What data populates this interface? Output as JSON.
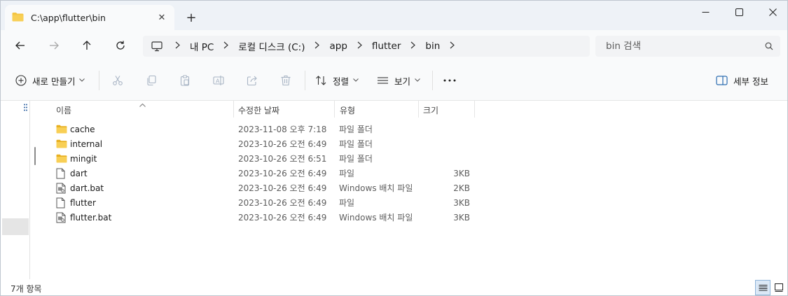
{
  "window": {
    "tab_title": "C:\\app\\flutter\\bin",
    "tab_close": "✕",
    "new_tab": "+"
  },
  "address": {
    "crumbs": [
      "내 PC",
      "로컬 디스크 (C:)",
      "app",
      "flutter",
      "bin"
    ]
  },
  "search": {
    "placeholder": "bin 검색"
  },
  "commands": {
    "new_label": "새로 만들기",
    "sort_label": "정렬",
    "view_label": "보기",
    "details_label": "세부 정보"
  },
  "columns": {
    "name": "이름",
    "modified": "수정한 날짜",
    "type": "유형",
    "size": "크기"
  },
  "files": [
    {
      "name": "cache",
      "modified": "2023-11-08 오후 7:18",
      "type": "파일 폴더",
      "size": "",
      "icon": "folder-icon"
    },
    {
      "name": "internal",
      "modified": "2023-10-26 오전 6:49",
      "type": "파일 폴더",
      "size": "",
      "icon": "folder-icon"
    },
    {
      "name": "mingit",
      "modified": "2023-10-26 오전 6:51",
      "type": "파일 폴더",
      "size": "",
      "icon": "folder-icon"
    },
    {
      "name": "dart",
      "modified": "2023-10-26 오전 6:49",
      "type": "파일",
      "size": "3KB",
      "icon": "file-icon"
    },
    {
      "name": "dart.bat",
      "modified": "2023-10-26 오전 6:49",
      "type": "Windows 배치 파일",
      "size": "2KB",
      "icon": "batch-file-icon"
    },
    {
      "name": "flutter",
      "modified": "2023-10-26 오전 6:49",
      "type": "파일",
      "size": "3KB",
      "icon": "file-icon"
    },
    {
      "name": "flutter.bat",
      "modified": "2023-10-26 오전 6:49",
      "type": "Windows 배치 파일",
      "size": "3KB",
      "icon": "batch-file-icon"
    }
  ],
  "status": {
    "item_count": "7개 항목"
  },
  "colors": {
    "folder": "#f4c542",
    "folder_dark": "#e8b020",
    "titlebar_bg": "#eef2f7",
    "toolbar_bg": "#f9fafb",
    "accent": "#2b6cb0"
  }
}
